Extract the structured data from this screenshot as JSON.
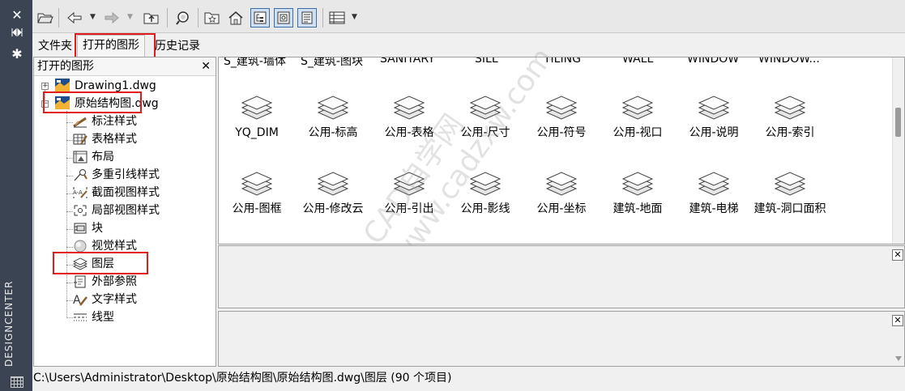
{
  "sidebar": {
    "close": "✕",
    "autohide": "⏴⏵",
    "properties": "✱",
    "vertical_title": "DESIGNCENTER"
  },
  "toolbar": {
    "icons": [
      "open-folder-icon",
      "back-arrow-icon",
      "forward-arrow-icon",
      "up-folder-icon",
      "search-icon",
      "favorites-icon",
      "home-icon",
      "tree-toggle-icon",
      "preview-icon",
      "description-icon",
      "views-icon"
    ]
  },
  "tabs": {
    "folders": "文件夹",
    "open_drawings": "打开的图形",
    "history": "历史记录"
  },
  "tree": {
    "header": "打开的图形",
    "close": "✕",
    "drawings": [
      {
        "label": "Drawing1.dwg"
      },
      {
        "label": "原始结构图.dwg"
      }
    ],
    "children": [
      {
        "label": "标注样式",
        "icon": "dimstyle-icon"
      },
      {
        "label": "表格样式",
        "icon": "tablestyle-icon"
      },
      {
        "label": "布局",
        "icon": "layout-icon"
      },
      {
        "label": "多重引线样式",
        "icon": "mleader-icon"
      },
      {
        "label": "截面视图样式",
        "icon": "section-view-icon"
      },
      {
        "label": "局部视图样式",
        "icon": "detail-view-icon"
      },
      {
        "label": "块",
        "icon": "block-icon"
      },
      {
        "label": "视觉样式",
        "icon": "visualstyle-icon"
      },
      {
        "label": "图层",
        "icon": "layer-icon"
      },
      {
        "label": "外部参照",
        "icon": "xref-icon"
      },
      {
        "label": "文字样式",
        "icon": "textstyle-icon"
      },
      {
        "label": "线型",
        "icon": "linetype-icon"
      }
    ]
  },
  "content": {
    "cut_row": [
      "S_建筑-墙体",
      "S_建筑-图块",
      "SANITARY",
      "SILL",
      "TILING",
      "WALL",
      "WINDOW",
      "WINDOW..."
    ],
    "row1": [
      "YQ_DIM",
      "公用-标高",
      "公用-表格",
      "公用-尺寸",
      "公用-符号",
      "公用-视口",
      "公用-说明",
      "公用-索引"
    ],
    "row2": [
      "公用-图框",
      "公用-修改云",
      "公用-引出",
      "公用-影线",
      "公用-坐标",
      "建筑-地面",
      "建筑-电梯",
      "建筑-洞口面积"
    ]
  },
  "panes": {
    "preview_close": "✕",
    "description_close": "✕"
  },
  "status": {
    "path": "C:\\Users\\Administrator\\Desktop\\原始结构图\\原始结构图.dwg\\图层 (90 个项目)"
  },
  "watermark": {
    "text": "CAD自学网 www.cadzxw.com"
  }
}
